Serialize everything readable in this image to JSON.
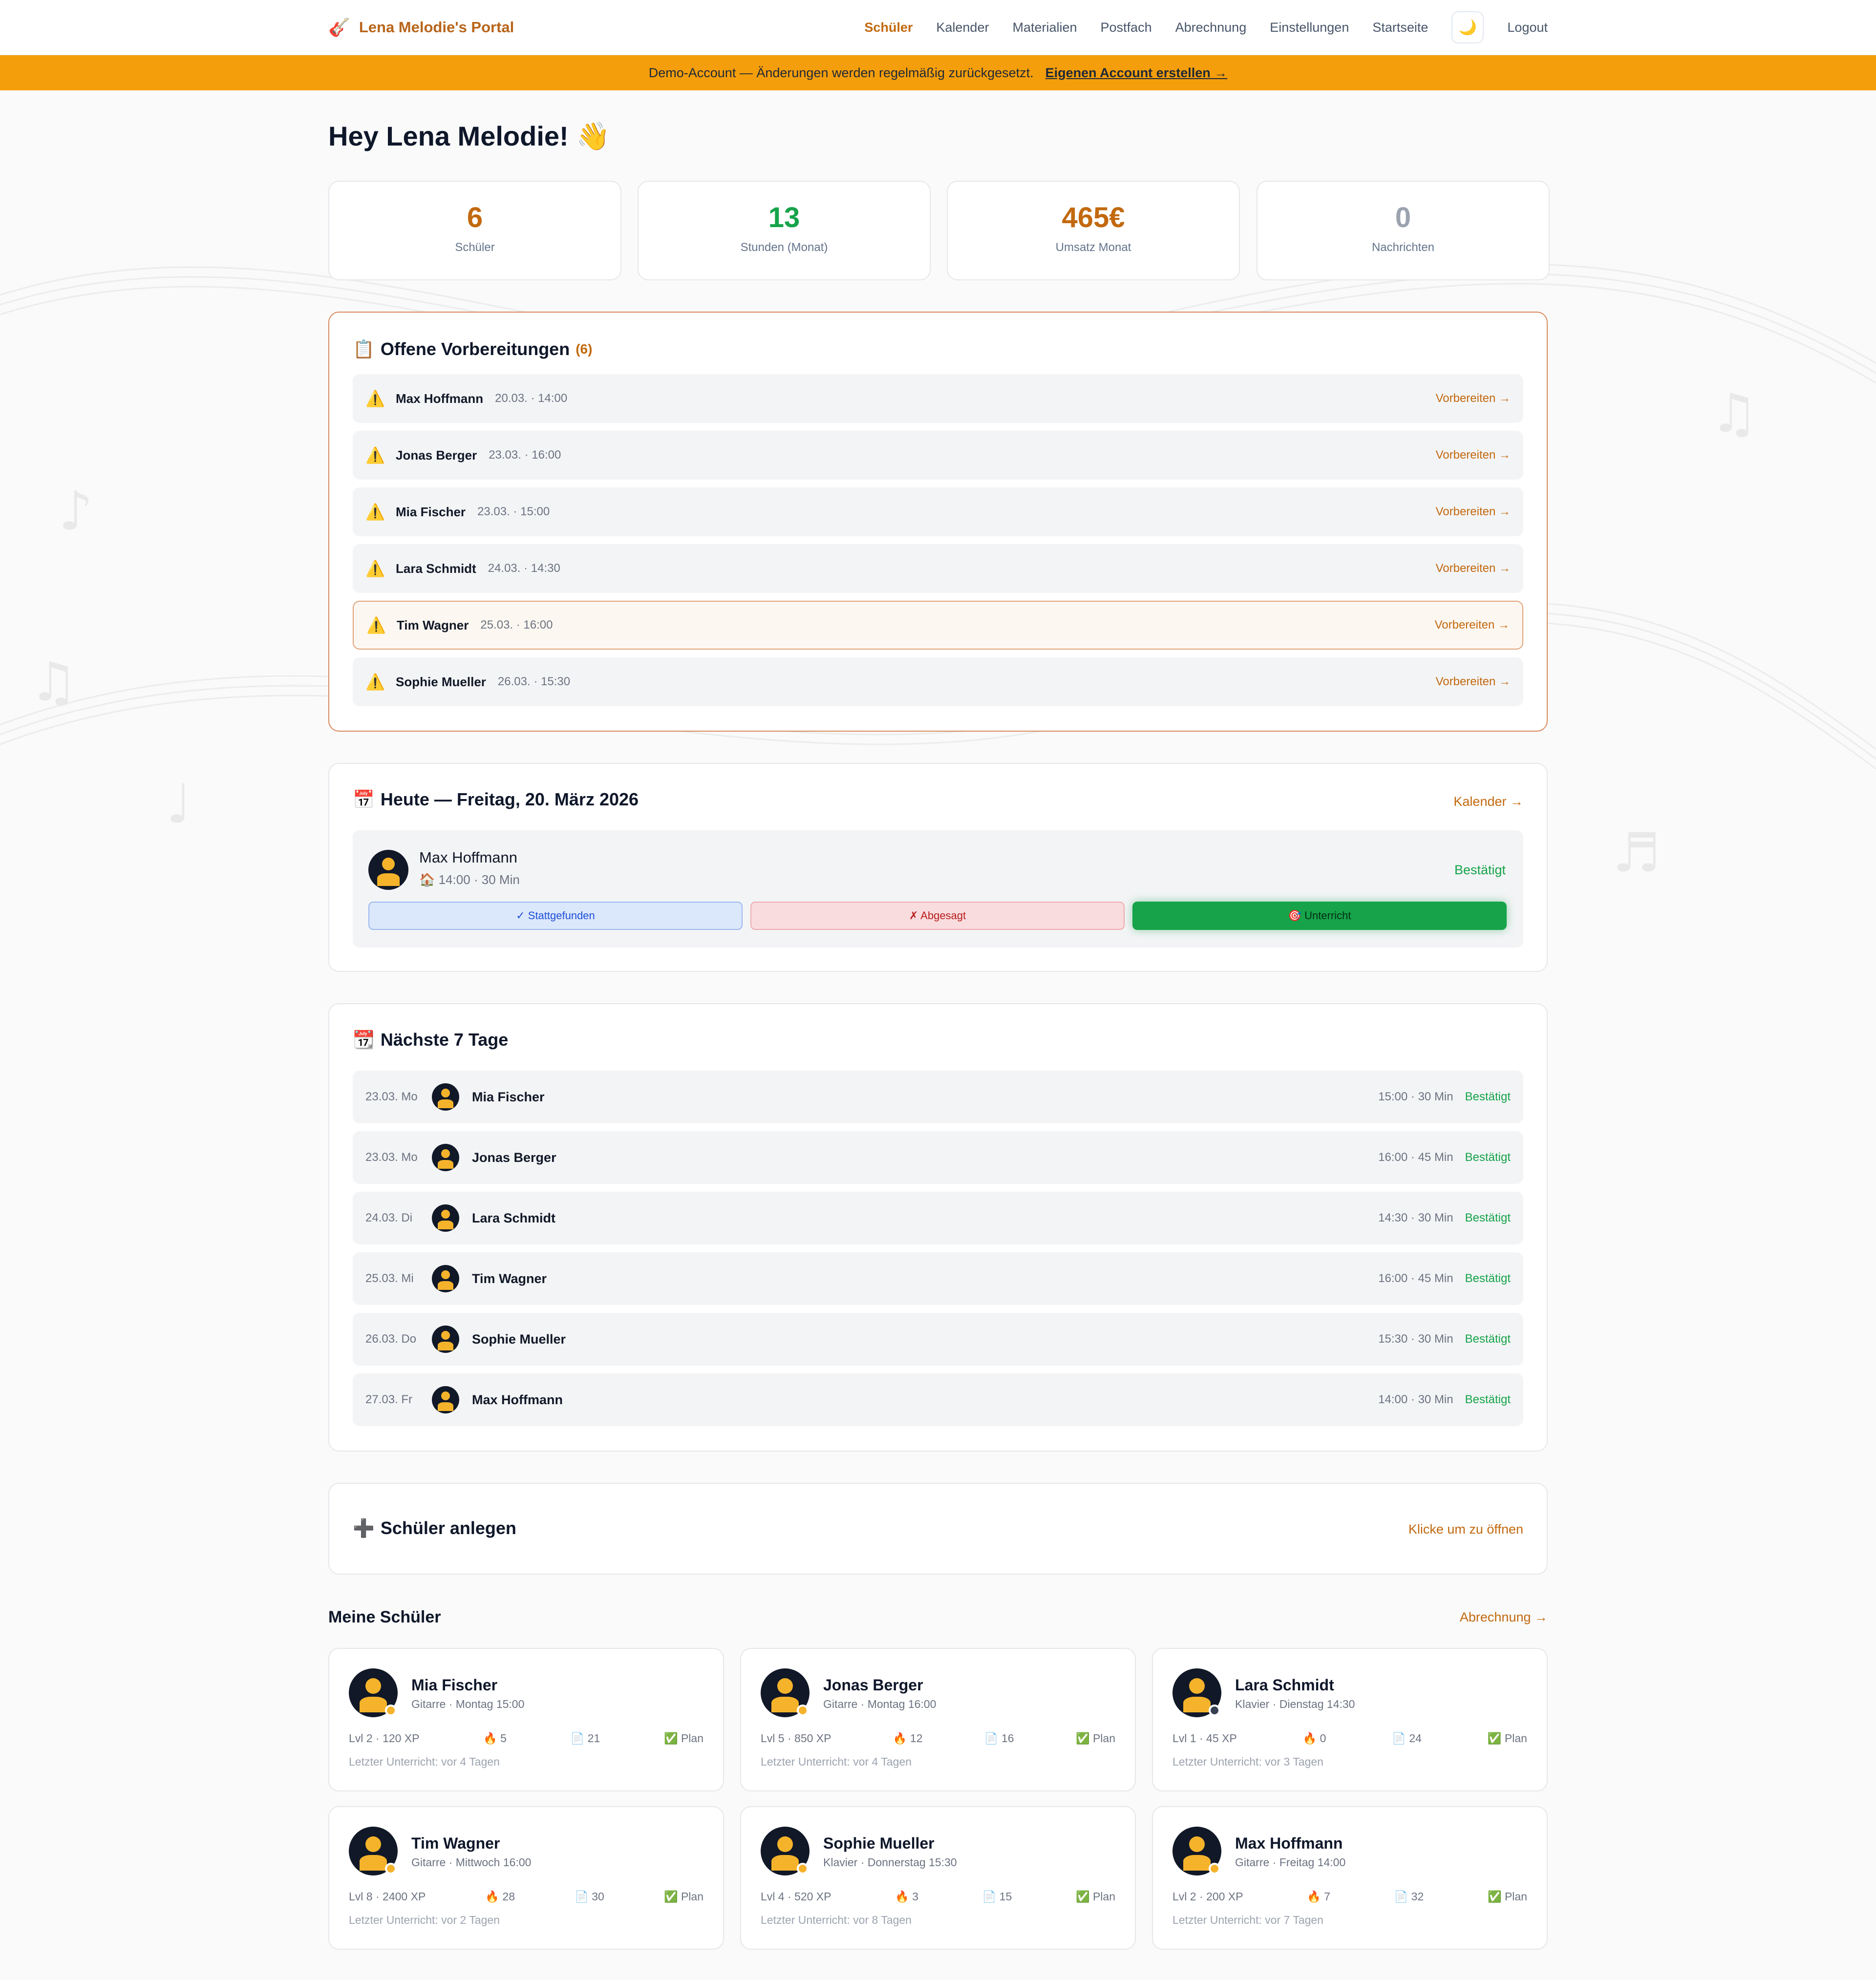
{
  "nav": {
    "brand": "Lena Melodie's Portal",
    "brand_icon": "🎸",
    "links": [
      "Schüler",
      "Kalender",
      "Materialien",
      "Postfach",
      "Abrechnung",
      "Einstellungen",
      "Startseite"
    ],
    "active": "Schüler",
    "theme_icon": "🌙",
    "logout": "Logout"
  },
  "banner": {
    "text": "Demo-Account — Änderungen werden regelmäßig zurückgesetzt.",
    "link": "Eigenen Account erstellen →"
  },
  "greeting": "Hey Lena Melodie! 👋",
  "stats": [
    {
      "value": "6",
      "label": "Schüler",
      "color": "#c2690f"
    },
    {
      "value": "13",
      "label": "Stunden (Monat)",
      "color": "#16a34a"
    },
    {
      "value": "465€",
      "label": "Umsatz Monat",
      "color": "#c2690f"
    },
    {
      "value": "0",
      "label": "Nachrichten",
      "color": "#9ca3af"
    }
  ],
  "prep": {
    "icon": "📋",
    "title": "Offene Vorbereitungen",
    "count": "(6)",
    "action": "Vorbereiten →",
    "items": [
      {
        "name": "Max Hoffmann",
        "date": "20.03. · 14:00"
      },
      {
        "name": "Jonas Berger",
        "date": "23.03. · 16:00"
      },
      {
        "name": "Mia Fischer",
        "date": "23.03. · 15:00"
      },
      {
        "name": "Lara Schmidt",
        "date": "24.03. · 14:30"
      },
      {
        "name": "Tim Wagner",
        "date": "25.03. · 16:00"
      },
      {
        "name": "Sophie Mueller",
        "date": "26.03. · 15:30"
      }
    ]
  },
  "today": {
    "icon": "📅",
    "title": "Heute — Freitag, 20. März 2026",
    "link": "Kalender →",
    "student": "Max Hoffmann",
    "detail": "🏠 14:00 · 30 Min",
    "status": "Bestätigt",
    "btn_done": "✓ Stattgefunden",
    "btn_cancel": "✗ Abgesagt",
    "btn_lesson": "🎯 Unterricht"
  },
  "week": {
    "icon": "📆",
    "title": "Nächste 7 Tage",
    "items": [
      {
        "date": "23.03. Mo",
        "name": "Mia Fischer",
        "time": "15:00 · 30 Min",
        "status": "Bestätigt"
      },
      {
        "date": "23.03. Mo",
        "name": "Jonas Berger",
        "time": "16:00 · 45 Min",
        "status": "Bestätigt"
      },
      {
        "date": "24.03. Di",
        "name": "Lara Schmidt",
        "time": "14:30 · 30 Min",
        "status": "Bestätigt"
      },
      {
        "date": "25.03. Mi",
        "name": "Tim Wagner",
        "time": "16:00 · 45 Min",
        "status": "Bestätigt"
      },
      {
        "date": "26.03. Do",
        "name": "Sophie Mueller",
        "time": "15:30 · 30 Min",
        "status": "Bestätigt"
      },
      {
        "date": "27.03. Fr",
        "name": "Max Hoffmann",
        "time": "14:00 · 30 Min",
        "status": "Bestätigt"
      }
    ]
  },
  "add": {
    "icon": "➕",
    "title": "Schüler anlegen",
    "hint": "Klicke um zu öffnen"
  },
  "students": {
    "title": "Meine Schüler",
    "link": "Abrechnung →",
    "items": [
      {
        "name": "Mia Fischer",
        "sub": "Gitarre · Montag 15:00",
        "level": "Lvl 2 · 120 XP",
        "streak": "🔥 5",
        "docs": "📄 21",
        "plan": "✅ Plan",
        "last": "Letzter Unterricht: vor 4 Tagen",
        "dot": "#f5b32b"
      },
      {
        "name": "Jonas Berger",
        "sub": "Gitarre · Montag 16:00",
        "level": "Lvl 5 · 850 XP",
        "streak": "🔥 12",
        "docs": "📄 16",
        "plan": "✅ Plan",
        "last": "Letzter Unterricht: vor 4 Tagen",
        "dot": "#f5b32b"
      },
      {
        "name": "Lara Schmidt",
        "sub": "Klavier · Dienstag 14:30",
        "level": "Lvl 1 · 45 XP",
        "streak": "🔥 0",
        "docs": "📄 24",
        "plan": "✅ Plan",
        "last": "Letzter Unterricht: vor 3 Tagen",
        "dot": "#374151"
      },
      {
        "name": "Tim Wagner",
        "sub": "Gitarre · Mittwoch 16:00",
        "level": "Lvl 8 · 2400 XP",
        "streak": "🔥 28",
        "docs": "📄 30",
        "plan": "✅ Plan",
        "last": "Letzter Unterricht: vor 2 Tagen",
        "dot": "#f5b32b"
      },
      {
        "name": "Sophie Mueller",
        "sub": "Klavier · Donnerstag 15:30",
        "level": "Lvl 4 · 520 XP",
        "streak": "🔥 3",
        "docs": "📄 15",
        "plan": "✅ Plan",
        "last": "Letzter Unterricht: vor 8 Tagen",
        "dot": "#f5b32b"
      },
      {
        "name": "Max Hoffmann",
        "sub": "Gitarre · Freitag 14:00",
        "level": "Lvl 2 · 200 XP",
        "streak": "🔥 7",
        "docs": "📄 32",
        "plan": "✅ Plan",
        "last": "Letzter Unterricht: vor 7 Tagen",
        "dot": "#f5b32b"
      }
    ]
  }
}
